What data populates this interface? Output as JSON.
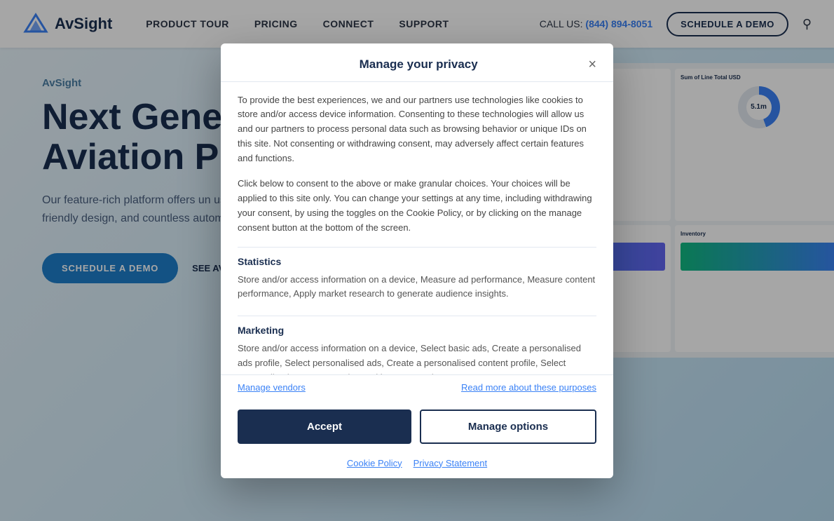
{
  "nav": {
    "logo_text": "AvSight",
    "links": [
      {
        "label": "PRODUCT TOUR",
        "name": "product-tour"
      },
      {
        "label": "PRICING",
        "name": "pricing"
      },
      {
        "label": "CONNECT",
        "name": "connect"
      },
      {
        "label": "SUPPORT",
        "name": "support"
      }
    ],
    "call_label": "CALL US:",
    "call_number": "(844) 894-8051",
    "demo_btn": "SCHEDULE A DEMO"
  },
  "hero": {
    "brand": "AvSight",
    "title_line1": "Next Gener",
    "title_line2": "Aviation Pla",
    "subtitle": "Our feature-rich platform offers un user friendly design, and countless automations.",
    "demo_btn": "SCHEDULE A DEMO",
    "see_btn": "SEE AV"
  },
  "modal": {
    "title": "Manage your privacy",
    "close_label": "×",
    "intro": "To provide the best experiences, we and our partners use technologies like cookies to store and/or access device information. Consenting to these technologies will allow us and our partners to process personal data such as browsing behavior or unique IDs on this site. Not consenting or withdrawing consent, may adversely affect certain features and functions.",
    "click_below": "Click below to consent to the above or make granular choices. Your choices will be applied to this site only. You can change your settings at any time, including withdrawing your consent, by using the toggles on the Cookie Policy, or by clicking on the manage consent button at the bottom of the screen.",
    "sections": [
      {
        "title": "Statistics",
        "desc": "Store and/or access information on a device, Measure ad performance, Measure content performance, Apply market research to generate audience insights."
      },
      {
        "title": "Marketing",
        "desc": "Store and/or access information on a device, Select basic ads, Create a personalised ads profile, Select personalised ads, Create a personalised content profile, Select personalised content, Develop and improve products."
      }
    ],
    "manage_vendors_link": "Manage vendors",
    "read_more_link": "Read more about these purposes",
    "accept_btn": "Accept",
    "manage_btn": "Manage options",
    "cookie_policy_link": "Cookie Policy",
    "privacy_link": "Privacy Statement"
  }
}
